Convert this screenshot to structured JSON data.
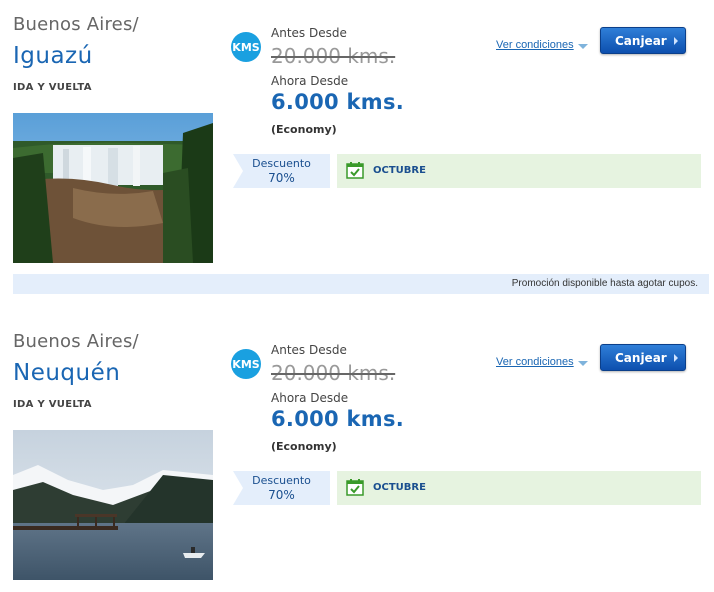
{
  "offers": [
    {
      "origin": "Buenos Aires/",
      "destination": "Iguazú",
      "trip_type": "IDA Y VUELTA",
      "kms_icon": "KMS",
      "before_label": "Antes Desde",
      "before_price": "20.000 kms.",
      "now_label": "Ahora Desde",
      "now_price": "6.000 kms.",
      "cabin": "(Economy)",
      "conditions_link": "Ver condiciones",
      "redeem_button": "Canjear",
      "discount_label": "Descuento",
      "discount_value": "70%",
      "month": "OCTUBRE",
      "promo_note": "Promoción disponible hasta agotar cupos."
    },
    {
      "origin": "Buenos Aires/",
      "destination": "Neuquén",
      "trip_type": "IDA Y VUELTA",
      "kms_icon": "KMS",
      "before_label": "Antes Desde",
      "before_price": "20.000 kms.",
      "now_label": "Ahora Desde",
      "now_price": "6.000 kms.",
      "cabin": "(Economy)",
      "conditions_link": "Ver condiciones",
      "redeem_button": "Canjear",
      "discount_label": "Descuento",
      "discount_value": "70%",
      "month": "OCTUBRE"
    }
  ],
  "colors": {
    "accent_blue": "#1a66b3",
    "kms_badge": "#1aa0e0",
    "discount_bg": "#e4eefb",
    "month_bg": "#e6f3e0",
    "calendar_green": "#3a9a2a"
  }
}
